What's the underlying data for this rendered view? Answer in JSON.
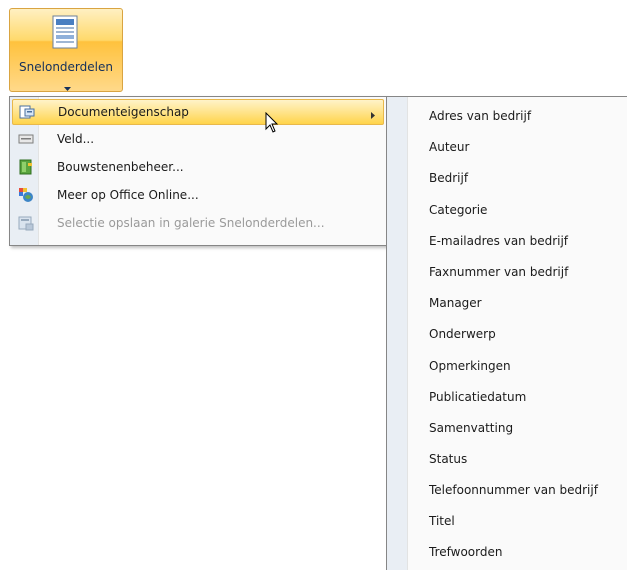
{
  "ribbon": {
    "button_label": "Snelonderdelen",
    "icon": "quick-parts-icon"
  },
  "menu": {
    "items": [
      {
        "label": "Documenteigenschap",
        "icon": "document-property-icon",
        "highlighted": true,
        "submenu": true
      },
      {
        "label": "Veld...",
        "icon": "field-icon"
      },
      {
        "label": "Bouwstenenbeheer...",
        "icon": "building-blocks-icon"
      },
      {
        "label": "Meer op Office Online...",
        "icon": "office-online-icon"
      },
      {
        "label": "Selectie opslaan in galerie Snelonderdelen...",
        "icon": "save-selection-icon",
        "disabled": true
      }
    ]
  },
  "submenu": {
    "items": [
      "Adres van bedrijf",
      "Auteur",
      "Bedrijf",
      "Categorie",
      "E-mailadres van bedrijf",
      "Faxnummer van bedrijf",
      "Manager",
      "Onderwerp",
      "Opmerkingen",
      "Publicatiedatum",
      "Samenvatting",
      "Status",
      "Telefoonnummer van bedrijf",
      "Titel",
      "Trefwoorden"
    ]
  },
  "colors": {
    "highlight": "#ffd44a",
    "ribbon_text": "#15305a",
    "disabled_text": "#9a9a9a"
  }
}
